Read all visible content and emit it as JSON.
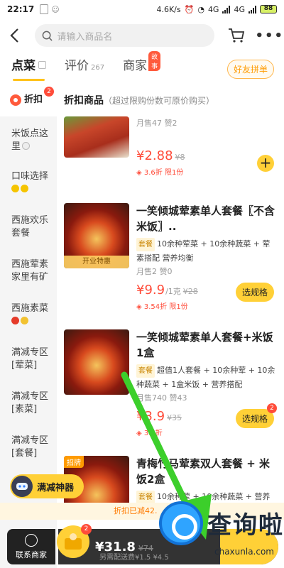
{
  "status_bar": {
    "time": "22:17",
    "speed": "4.6K/s",
    "net1": "4G",
    "net2": "4G",
    "battery": "88"
  },
  "header": {
    "search_placeholder": "请输入商品名"
  },
  "tabs": [
    {
      "label": "点菜",
      "sub": ""
    },
    {
      "label": "评价",
      "sub": "267"
    },
    {
      "label": "商家",
      "sub": "",
      "badge": "故事"
    }
  ],
  "friend_button": "好友拼单",
  "sidebar": {
    "items": [
      {
        "label": "折扣",
        "badge": "2"
      },
      {
        "label": "米饭点这里"
      },
      {
        "label": "口味选择"
      },
      {
        "label": "西施欢乐套餐"
      },
      {
        "label": "西施荤素家里有矿"
      },
      {
        "label": "西施素菜"
      },
      {
        "label": "满减专区[荤菜]"
      },
      {
        "label": "满减专区[素菜]"
      },
      {
        "label": "满减专区[套餐]"
      }
    ]
  },
  "section": {
    "title": "折扣商品",
    "note": "（超过限购份数可原价购买）"
  },
  "items": [
    {
      "name": "",
      "tags_prefix": "",
      "tags": "",
      "sales": "月售47  赞2",
      "price": "¥2.88",
      "unit": "",
      "old_price": "¥8",
      "discount": "3.6折 限1份",
      "action": "+"
    },
    {
      "name": "一笑倾城荤素单人套餐〖不含米饭〗..",
      "tags_prefix": "套餐",
      "tags": "10余种荤菜 + 10余种蔬菜 + 荤素搭配 营养均衡",
      "sales": "月售2  赞0",
      "price": "¥9.9",
      "unit": "/1克",
      "old_price": "¥28",
      "discount": "3.54折 限1份",
      "action": "选规格",
      "ribbon": "开业特惠"
    },
    {
      "name": "一笑倾城荤素单人套餐+米饭1盒",
      "tags_prefix": "套餐",
      "tags": "超值1人套餐 + 10余种荤 + 10余种蔬菜 + 1盒米饭 + 营养搭配",
      "sales": "月售740  赞43",
      "price": "¥3.9",
      "unit": "",
      "old_price": "¥35",
      "discount": "3.5折",
      "action": "选规格",
      "action_badge": "2"
    },
    {
      "name": "青梅竹马荤素双人套餐 + 米饭2盒",
      "tags_prefix": "套餐",
      "tags": "10余种荤 + 10余种蔬菜 + 营养",
      "sales": "",
      "price": "",
      "unit": "",
      "old_price": "",
      "discount": "",
      "action": "",
      "zhaopai": "招牌"
    }
  ],
  "helper": {
    "label": "满减神器"
  },
  "notice": {
    "text": "折扣已减42."
  },
  "bottom": {
    "contact_label": "联系商家",
    "cart_count": "2",
    "total": "¥31.8",
    "total_old": "¥74",
    "delivery": "另需配送费¥1.5  ¥4.5"
  },
  "watermark": {
    "text": "查询啦",
    "url": "chaxunla.com"
  },
  "colors": {
    "accent": "#ffd037",
    "price": "#ff4c3a",
    "arrow": "#3ccf2b"
  }
}
